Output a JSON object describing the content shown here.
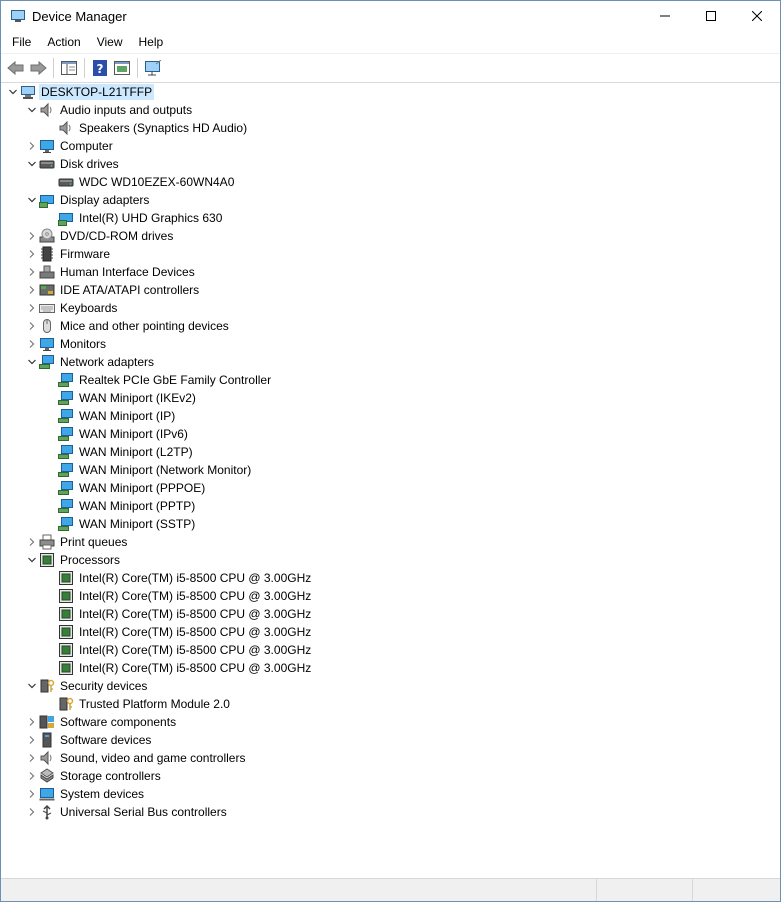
{
  "window": {
    "title": "Device Manager"
  },
  "menu": [
    "File",
    "Action",
    "View",
    "Help"
  ],
  "toolbar": [
    {
      "name": "back-button",
      "icon": "back-arrow-icon"
    },
    {
      "name": "forward-button",
      "icon": "forward-arrow-icon"
    },
    {
      "name": "show-hide-console-tree-button",
      "icon": "console-tree-icon"
    },
    {
      "name": "help-button",
      "icon": "help-icon"
    },
    {
      "name": "properties-pane-button",
      "icon": "properties-icon"
    },
    {
      "name": "scan-hardware-button",
      "icon": "monitor-scan-icon"
    }
  ],
  "tree": {
    "root": "DESKTOP-L21TFFP",
    "categories": [
      {
        "label": "Audio inputs and outputs",
        "icon": "speaker",
        "expanded": true,
        "children": [
          {
            "label": "Speakers (Synaptics HD Audio)",
            "icon": "speaker"
          }
        ]
      },
      {
        "label": "Computer",
        "icon": "monitor",
        "expanded": false,
        "children": []
      },
      {
        "label": "Disk drives",
        "icon": "disk",
        "expanded": true,
        "children": [
          {
            "label": "WDC WD10EZEX-60WN4A0",
            "icon": "disk"
          }
        ]
      },
      {
        "label": "Display adapters",
        "icon": "display",
        "expanded": true,
        "children": [
          {
            "label": "Intel(R) UHD Graphics 630",
            "icon": "display"
          }
        ]
      },
      {
        "label": "DVD/CD-ROM drives",
        "icon": "dvd",
        "expanded": false,
        "children": []
      },
      {
        "label": "Firmware",
        "icon": "chip",
        "expanded": false,
        "children": []
      },
      {
        "label": "Human Interface Devices",
        "icon": "hid",
        "expanded": false,
        "children": []
      },
      {
        "label": "IDE ATA/ATAPI controllers",
        "icon": "ide",
        "expanded": false,
        "children": []
      },
      {
        "label": "Keyboards",
        "icon": "keyboard",
        "expanded": false,
        "children": []
      },
      {
        "label": "Mice and other pointing devices",
        "icon": "mouse",
        "expanded": false,
        "children": []
      },
      {
        "label": "Monitors",
        "icon": "monitor",
        "expanded": false,
        "children": []
      },
      {
        "label": "Network adapters",
        "icon": "network",
        "expanded": true,
        "children": [
          {
            "label": "Realtek PCIe GbE Family Controller",
            "icon": "network"
          },
          {
            "label": "WAN Miniport (IKEv2)",
            "icon": "network"
          },
          {
            "label": "WAN Miniport (IP)",
            "icon": "network"
          },
          {
            "label": "WAN Miniport (IPv6)",
            "icon": "network"
          },
          {
            "label": "WAN Miniport (L2TP)",
            "icon": "network"
          },
          {
            "label": "WAN Miniport (Network Monitor)",
            "icon": "network"
          },
          {
            "label": "WAN Miniport (PPPOE)",
            "icon": "network"
          },
          {
            "label": "WAN Miniport (PPTP)",
            "icon": "network"
          },
          {
            "label": "WAN Miniport (SSTP)",
            "icon": "network"
          }
        ]
      },
      {
        "label": "Print queues",
        "icon": "printer",
        "expanded": false,
        "children": []
      },
      {
        "label": "Processors",
        "icon": "cpu",
        "expanded": true,
        "children": [
          {
            "label": "Intel(R) Core(TM) i5-8500 CPU @ 3.00GHz",
            "icon": "cpu"
          },
          {
            "label": "Intel(R) Core(TM) i5-8500 CPU @ 3.00GHz",
            "icon": "cpu"
          },
          {
            "label": "Intel(R) Core(TM) i5-8500 CPU @ 3.00GHz",
            "icon": "cpu"
          },
          {
            "label": "Intel(R) Core(TM) i5-8500 CPU @ 3.00GHz",
            "icon": "cpu"
          },
          {
            "label": "Intel(R) Core(TM) i5-8500 CPU @ 3.00GHz",
            "icon": "cpu"
          },
          {
            "label": "Intel(R) Core(TM) i5-8500 CPU @ 3.00GHz",
            "icon": "cpu"
          }
        ]
      },
      {
        "label": "Security devices",
        "icon": "security",
        "expanded": true,
        "children": [
          {
            "label": "Trusted Platform Module 2.0",
            "icon": "security"
          }
        ]
      },
      {
        "label": "Software components",
        "icon": "software",
        "expanded": false,
        "children": []
      },
      {
        "label": "Software devices",
        "icon": "softdev",
        "expanded": false,
        "children": []
      },
      {
        "label": "Sound, video and game controllers",
        "icon": "speaker",
        "expanded": false,
        "children": []
      },
      {
        "label": "Storage controllers",
        "icon": "storage",
        "expanded": false,
        "children": []
      },
      {
        "label": "System devices",
        "icon": "system",
        "expanded": false,
        "children": []
      },
      {
        "label": "Universal Serial Bus controllers",
        "icon": "usb",
        "expanded": false,
        "children": []
      }
    ]
  },
  "colors": {
    "selection": "#cce8ff",
    "accent": "#0078d7"
  }
}
